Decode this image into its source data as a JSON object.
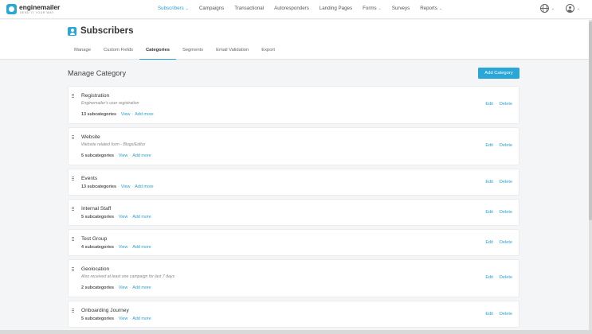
{
  "brand": {
    "name": "enginemailer",
    "tagline": "SEND IT YOUR WAY"
  },
  "nav": [
    {
      "label": "Subscribers",
      "dropdown": true,
      "active": true
    },
    {
      "label": "Campaigns",
      "dropdown": false
    },
    {
      "label": "Transactional",
      "dropdown": false
    },
    {
      "label": "Autoresponders",
      "dropdown": false
    },
    {
      "label": "Landing Pages",
      "dropdown": false
    },
    {
      "label": "Forms",
      "dropdown": true
    },
    {
      "label": "Surveys",
      "dropdown": false
    },
    {
      "label": "Reports",
      "dropdown": true
    }
  ],
  "caret": "⌄",
  "page": {
    "title": "Subscribers"
  },
  "tabs": [
    {
      "label": "Manage"
    },
    {
      "label": "Custom Fields"
    },
    {
      "label": "Categories",
      "active": true
    },
    {
      "label": "Segments"
    },
    {
      "label": "Email Validation"
    },
    {
      "label": "Export"
    }
  ],
  "section": {
    "title": "Manage Category",
    "add_label": "Add Category"
  },
  "labels": {
    "view": "View",
    "add_more": "Add more",
    "edit": "Edit",
    "delete": "Delete",
    "sep": "·"
  },
  "categories": [
    {
      "name": "Registration",
      "description": "Enginemailer's user registration",
      "count": "13 subcategories"
    },
    {
      "name": "Website",
      "description": "Website related form - Blogs/Editor",
      "count": "5 subcategories"
    },
    {
      "name": "Events",
      "description": "",
      "count": "13 subcategories"
    },
    {
      "name": "Internal Staff",
      "description": "",
      "count": "5 subcategories"
    },
    {
      "name": "Test Group",
      "description": "",
      "count": "4 subcategories"
    },
    {
      "name": "Geolocation",
      "description": "Also received at least one campaign for last 7 days",
      "count": "2 subcategories"
    },
    {
      "name": "Onboarding Journey",
      "description": "",
      "count": "5 subcategories"
    }
  ],
  "colors": {
    "accent": "#2aa7d8",
    "link": "#2a9fd6"
  },
  "icons": {
    "language": "globe-icon",
    "account": "user-icon",
    "drag": "drag-handle-icon"
  }
}
